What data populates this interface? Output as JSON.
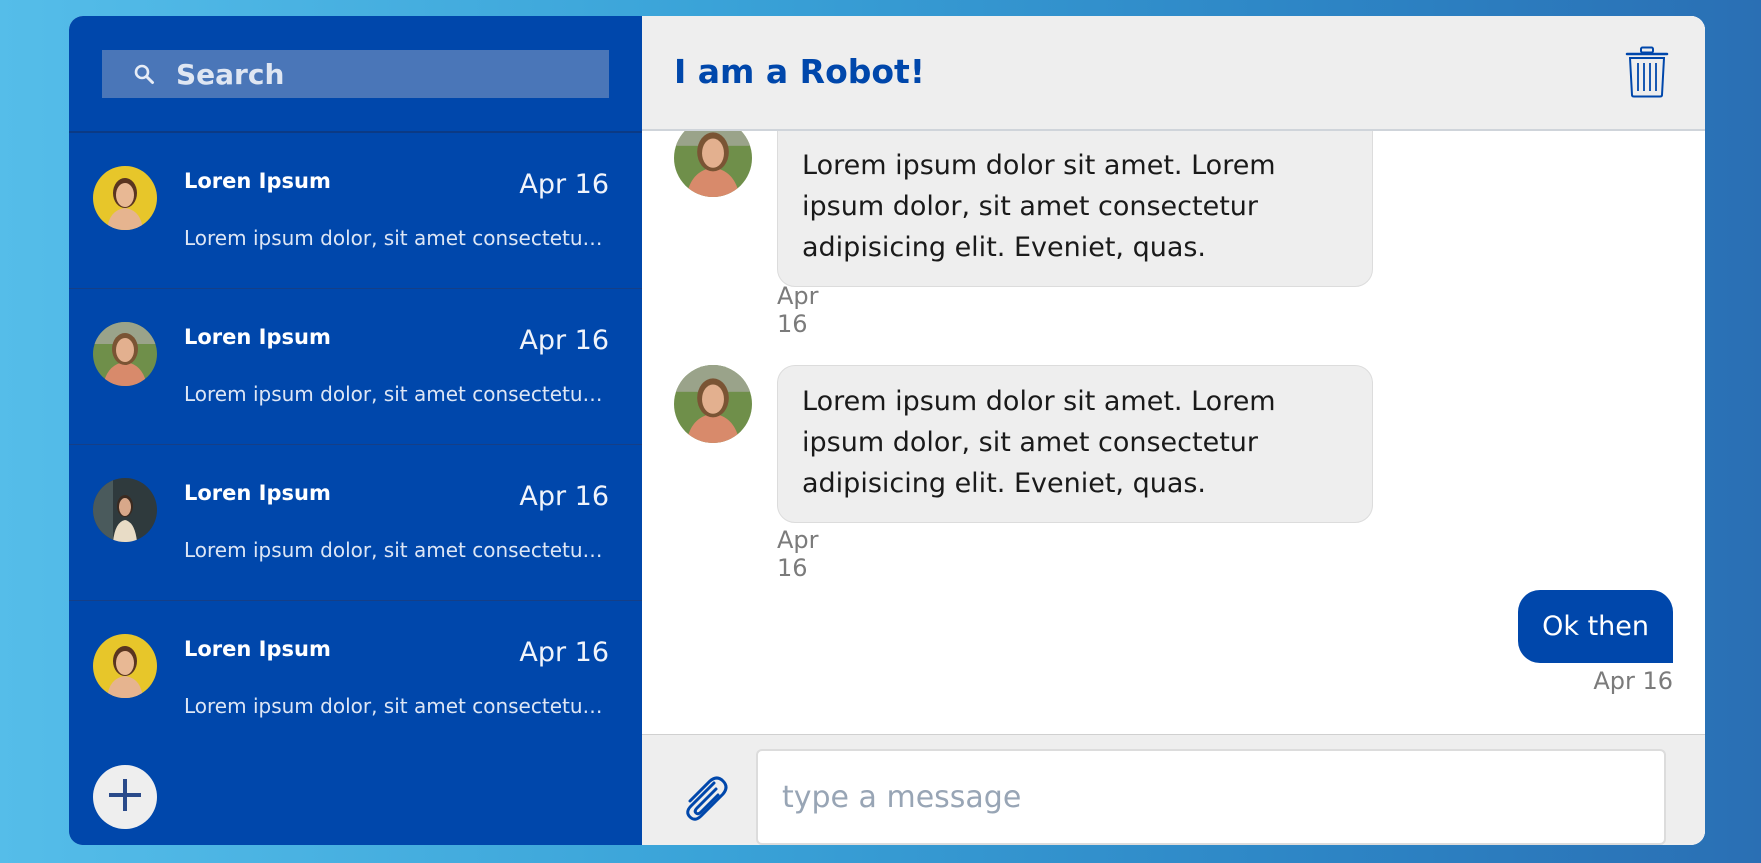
{
  "colors": {
    "primary": "#0047ab",
    "sidebar_search_bg": "#4a76b8",
    "bubble_in_bg": "#eeeeee",
    "header_bg": "#eeeeee"
  },
  "sidebar": {
    "search": {
      "placeholder": "Search",
      "icon": "search-icon"
    },
    "conversations": [
      {
        "name": "Loren Ipsum",
        "date": "Apr 16",
        "preview": "Lorem ipsum dolor, sit amet consectetur adipisicing elit.",
        "avatar": "avatar-yellow"
      },
      {
        "name": "Loren Ipsum",
        "date": "Apr 16",
        "preview": "Lorem ipsum dolor, sit amet consectetur adipisicing elit.",
        "avatar": "avatar-green"
      },
      {
        "name": "Loren Ipsum",
        "date": "Apr 16",
        "preview": "Lorem ipsum dolor, sit amet consectetur adipisicing elit.",
        "avatar": "avatar-dark"
      },
      {
        "name": "Loren Ipsum",
        "date": "Apr 16",
        "preview": "Lorem ipsum dolor, sit amet consectetur adipisicing elit.",
        "avatar": "avatar-yellow"
      }
    ],
    "add_button_icon": "plus-icon"
  },
  "chat": {
    "title": "I am a Robot!",
    "delete_icon": "trash-icon",
    "messages": [
      {
        "direction": "in",
        "text": "Lorem ipsum dolor sit amet. Lorem ipsum dolor, sit amet consectetur adipisicing elit. Eveniet, quas.",
        "time": "Apr 16"
      },
      {
        "direction": "in",
        "text": "Lorem ipsum dolor sit amet. Lorem ipsum dolor, sit amet consectetur adipisicing elit. Eveniet, quas.",
        "time": "Apr 16"
      },
      {
        "direction": "out",
        "text": "Ok then",
        "time": "Apr 16"
      }
    ],
    "composer": {
      "placeholder": "type a message",
      "attach_icon": "paperclip-icon"
    }
  }
}
